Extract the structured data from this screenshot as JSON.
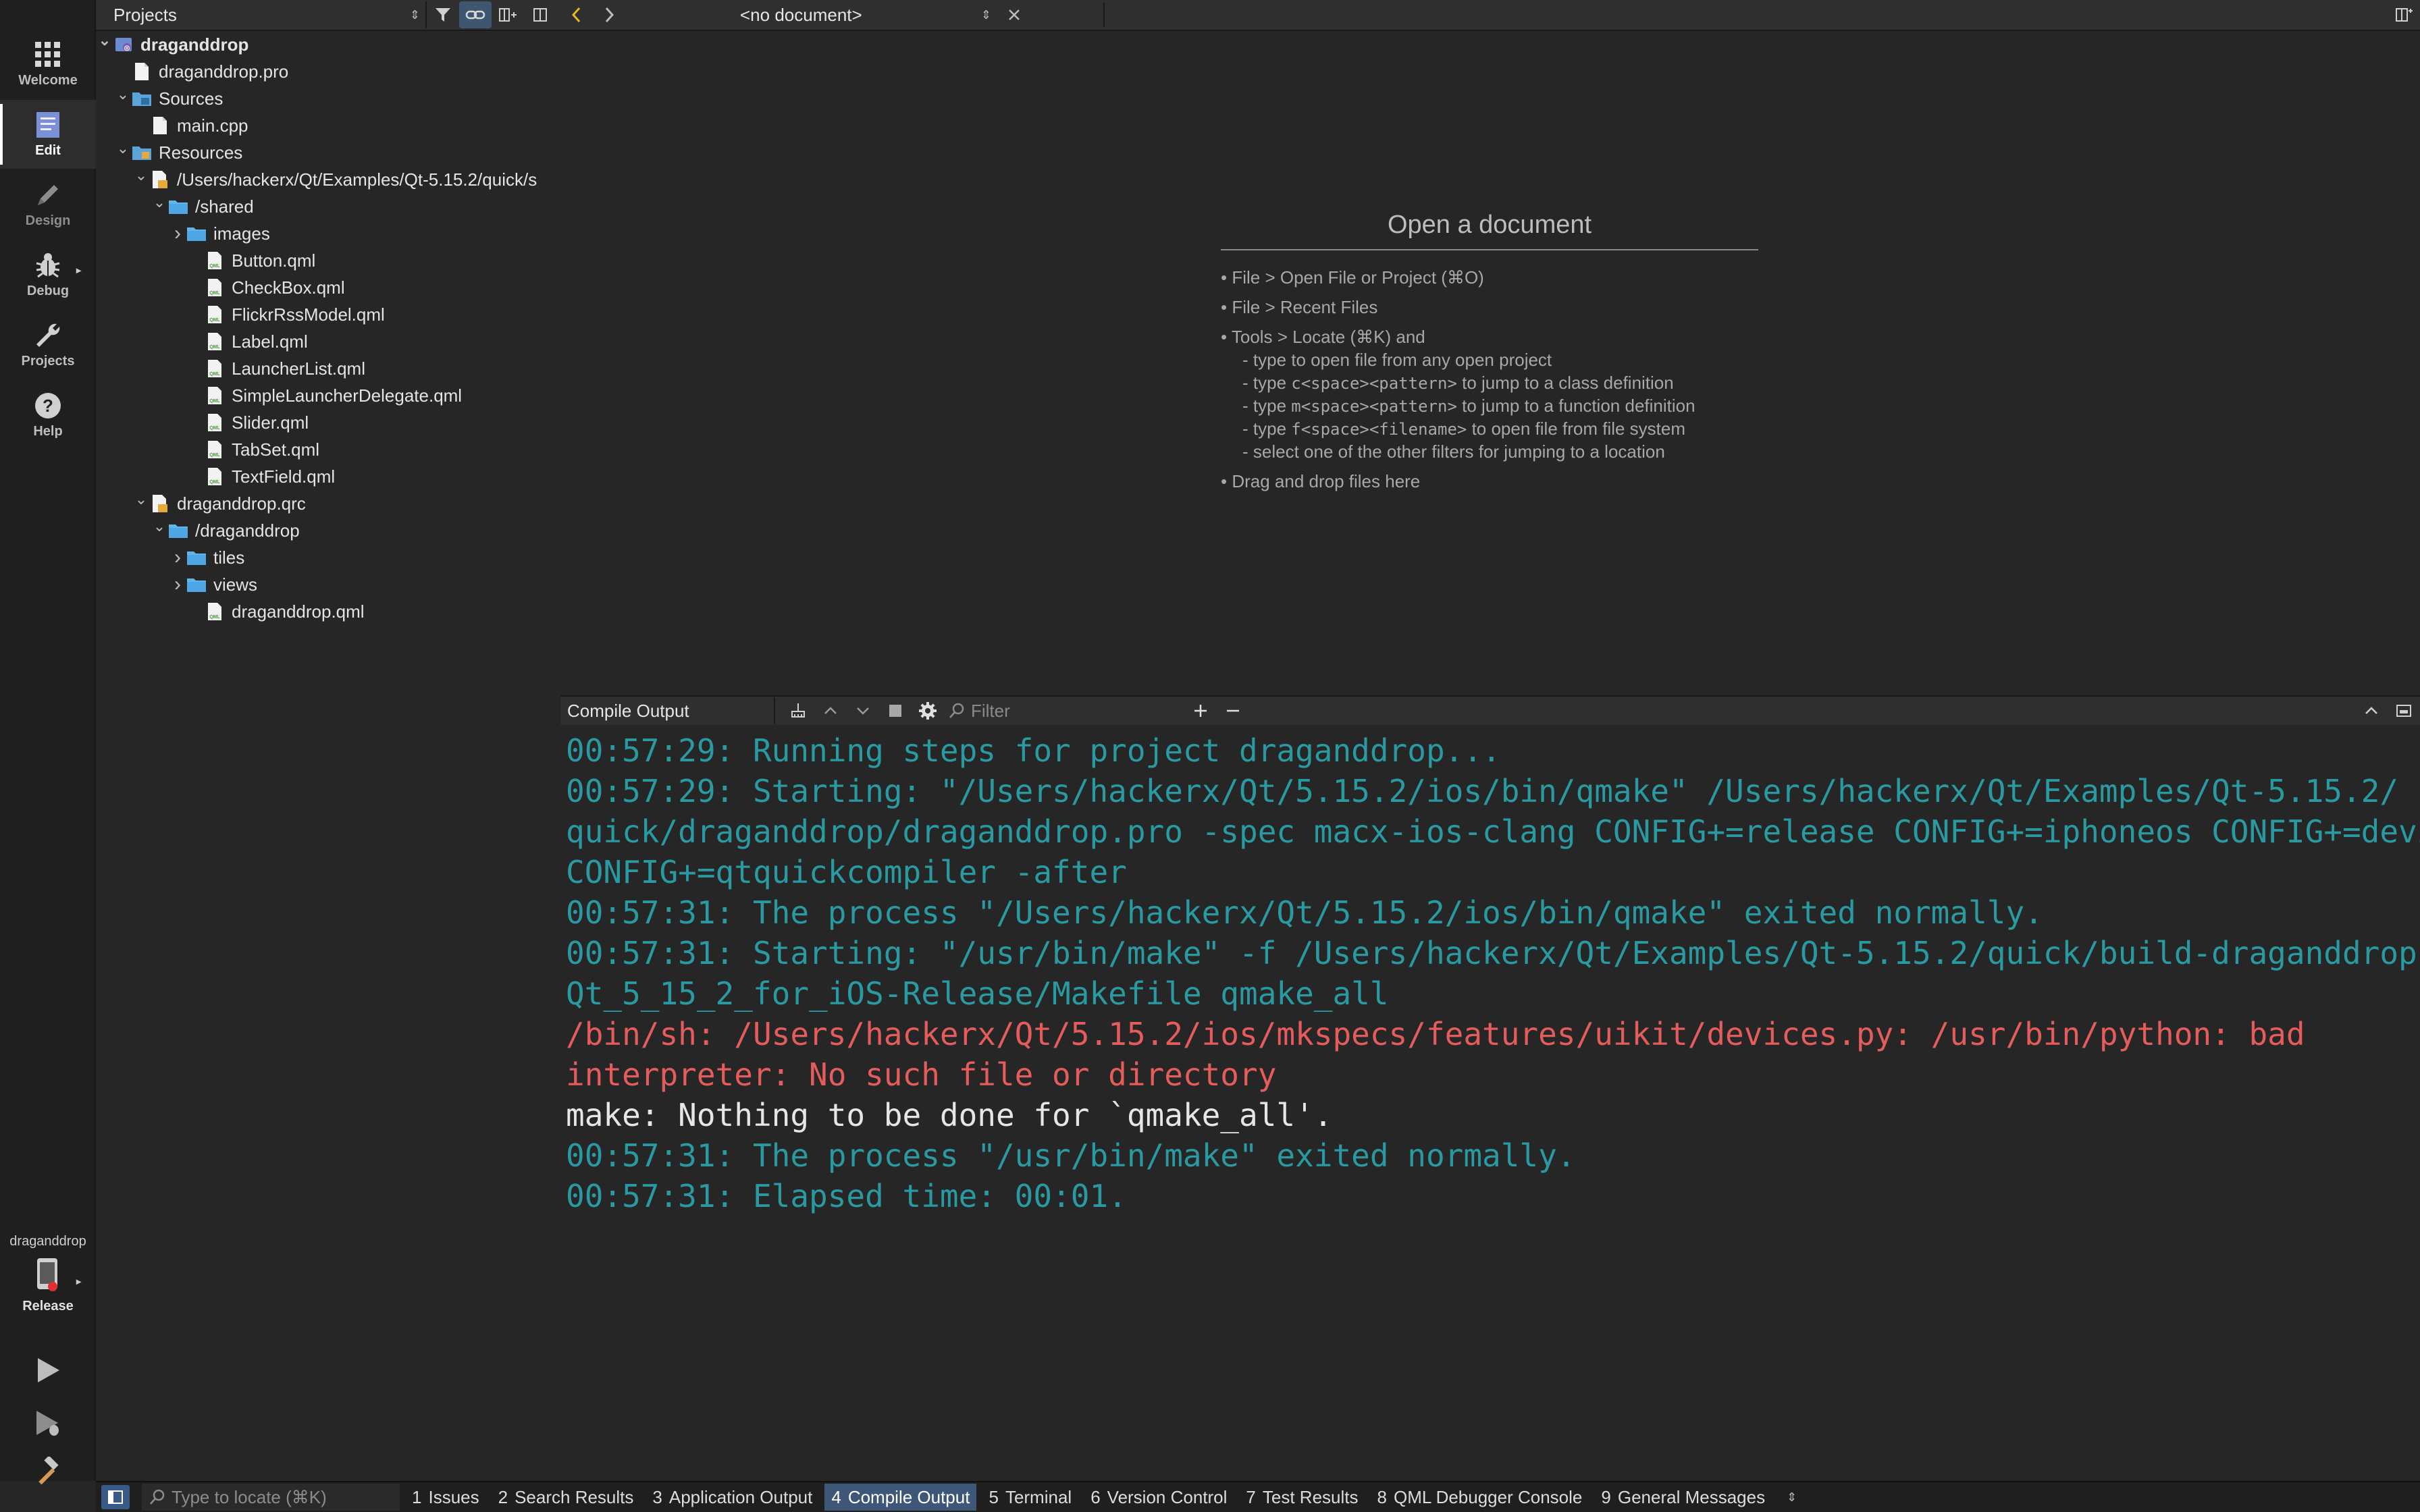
{
  "modes": [
    {
      "label": "Welcome",
      "icon": "grid-icon"
    },
    {
      "label": "Edit",
      "icon": "edit-document-icon"
    },
    {
      "label": "Design",
      "icon": "pencil-icon"
    },
    {
      "label": "Debug",
      "icon": "bug-icon"
    },
    {
      "label": "Projects",
      "icon": "wrench-icon"
    },
    {
      "label": "Help",
      "icon": "help-icon"
    }
  ],
  "kit": {
    "project": "draganddrop",
    "build_config": "Release"
  },
  "project_toolbar": {
    "view_selector": "Projects",
    "document_selector": "<no document>"
  },
  "tree": [
    {
      "label": "draganddrop",
      "depth": 0,
      "expanded": true,
      "icon": "qt-project-icon"
    },
    {
      "label": "draganddrop.pro",
      "depth": 1,
      "icon": "file-icon"
    },
    {
      "label": "Sources",
      "depth": 1,
      "expanded": true,
      "icon": "sources-folder-icon"
    },
    {
      "label": "main.cpp",
      "depth": 2,
      "icon": "file-icon"
    },
    {
      "label": "Resources",
      "depth": 1,
      "expanded": true,
      "icon": "resources-folder-icon"
    },
    {
      "label": "/Users/hackerx/Qt/Examples/Qt-5.15.2/quick/s",
      "depth": 2,
      "expanded": true,
      "icon": "qrc-file-icon"
    },
    {
      "label": "/shared",
      "depth": 3,
      "expanded": true,
      "icon": "folder-icon"
    },
    {
      "label": "images",
      "depth": 4,
      "expanded": false,
      "icon": "folder-icon"
    },
    {
      "label": "Button.qml",
      "depth": 5,
      "icon": "qml-file-icon"
    },
    {
      "label": "CheckBox.qml",
      "depth": 5,
      "icon": "qml-file-icon"
    },
    {
      "label": "FlickrRssModel.qml",
      "depth": 5,
      "icon": "qml-file-icon"
    },
    {
      "label": "Label.qml",
      "depth": 5,
      "icon": "qml-file-icon"
    },
    {
      "label": "LauncherList.qml",
      "depth": 5,
      "icon": "qml-file-icon"
    },
    {
      "label": "SimpleLauncherDelegate.qml",
      "depth": 5,
      "icon": "qml-file-icon"
    },
    {
      "label": "Slider.qml",
      "depth": 5,
      "icon": "qml-file-icon"
    },
    {
      "label": "TabSet.qml",
      "depth": 5,
      "icon": "qml-file-icon"
    },
    {
      "label": "TextField.qml",
      "depth": 5,
      "icon": "qml-file-icon"
    },
    {
      "label": "draganddrop.qrc",
      "depth": 2,
      "expanded": true,
      "icon": "qrc-file-icon"
    },
    {
      "label": "/draganddrop",
      "depth": 3,
      "expanded": true,
      "icon": "folder-icon"
    },
    {
      "label": "tiles",
      "depth": 4,
      "expanded": false,
      "icon": "folder-icon"
    },
    {
      "label": "views",
      "depth": 4,
      "expanded": false,
      "icon": "folder-icon"
    },
    {
      "label": "draganddrop.qml",
      "depth": 5,
      "icon": "qml-file-icon"
    }
  ],
  "open_document": {
    "title": "Open a document",
    "hints": [
      {
        "text": "• File > Open File or Project (⌘O)",
        "sub": false
      },
      {
        "text": "• File > Recent Files",
        "sub": false
      },
      {
        "text": "• Tools > Locate (⌘K) and",
        "sub": false
      },
      {
        "parts": [
          "- type to open file from any open project"
        ],
        "sub": true
      },
      {
        "parts": [
          "- type ",
          "c<space><pattern>",
          " to jump to a class definition"
        ],
        "sub": true
      },
      {
        "parts": [
          "- type ",
          "m<space><pattern>",
          " to jump to a function definition"
        ],
        "sub": true
      },
      {
        "parts": [
          "- type ",
          "f<space><filename>",
          " to open file from file system"
        ],
        "sub": true
      },
      {
        "parts": [
          "- select one of the other filters for jumping to a location"
        ],
        "sub": true
      },
      {
        "text": "• Drag and drop files here",
        "sub": false
      }
    ]
  },
  "output_pane": {
    "selector": "Compile Output",
    "filter_placeholder": "Filter",
    "lines": [
      {
        "text": "00:57:29: Running steps for project draganddrop...",
        "kind": "ok"
      },
      {
        "text": "00:57:29: Starting: \"/Users/hackerx/Qt/5.15.2/ios/bin/qmake\" /Users/hackerx/Qt/Examples/Qt-5.15.2/",
        "kind": "ok"
      },
      {
        "text": "quick/draganddrop/draganddrop.pro -spec macx-ios-clang CONFIG+=release CONFIG+=iphoneos CONFIG+=device",
        "kind": "ok"
      },
      {
        "text": "CONFIG+=qtquickcompiler -after",
        "kind": "ok"
      },
      {
        "text": "00:57:31: The process \"/Users/hackerx/Qt/5.15.2/ios/bin/qmake\" exited normally.",
        "kind": "ok"
      },
      {
        "text": "00:57:31: Starting: \"/usr/bin/make\" -f /Users/hackerx/Qt/Examples/Qt-5.15.2/quick/build-draganddrop-",
        "kind": "ok"
      },
      {
        "text": "Qt_5_15_2_for_iOS-Release/Makefile qmake_all",
        "kind": "ok"
      },
      {
        "text": "/bin/sh: /Users/hackerx/Qt/5.15.2/ios/mkspecs/features/uikit/devices.py: /usr/bin/python: bad",
        "kind": "err"
      },
      {
        "text": "interpreter: No such file or directory",
        "kind": "err"
      },
      {
        "text": "make: Nothing to be done for `qmake_all'.",
        "kind": "plain"
      },
      {
        "text": "00:57:31: The process \"/usr/bin/make\" exited normally.",
        "kind": "ok"
      },
      {
        "text": "00:57:31: Elapsed time: 00:01.",
        "kind": "ok"
      }
    ]
  },
  "statusbar": {
    "locator_placeholder": "Type to locate (⌘K)",
    "tabs": [
      {
        "num": "1",
        "label": "Issues"
      },
      {
        "num": "2",
        "label": "Search Results"
      },
      {
        "num": "3",
        "label": "Application Output"
      },
      {
        "num": "4",
        "label": "Compile Output",
        "active": true
      },
      {
        "num": "5",
        "label": "Terminal"
      },
      {
        "num": "6",
        "label": "Version Control"
      },
      {
        "num": "7",
        "label": "Test Results"
      },
      {
        "num": "8",
        "label": "QML Debugger Console"
      },
      {
        "num": "9",
        "label": "General Messages"
      }
    ]
  },
  "colors": {
    "output_ok": "#2a9aa2",
    "output_error": "#e55c5c",
    "accent": "#3e5778"
  }
}
